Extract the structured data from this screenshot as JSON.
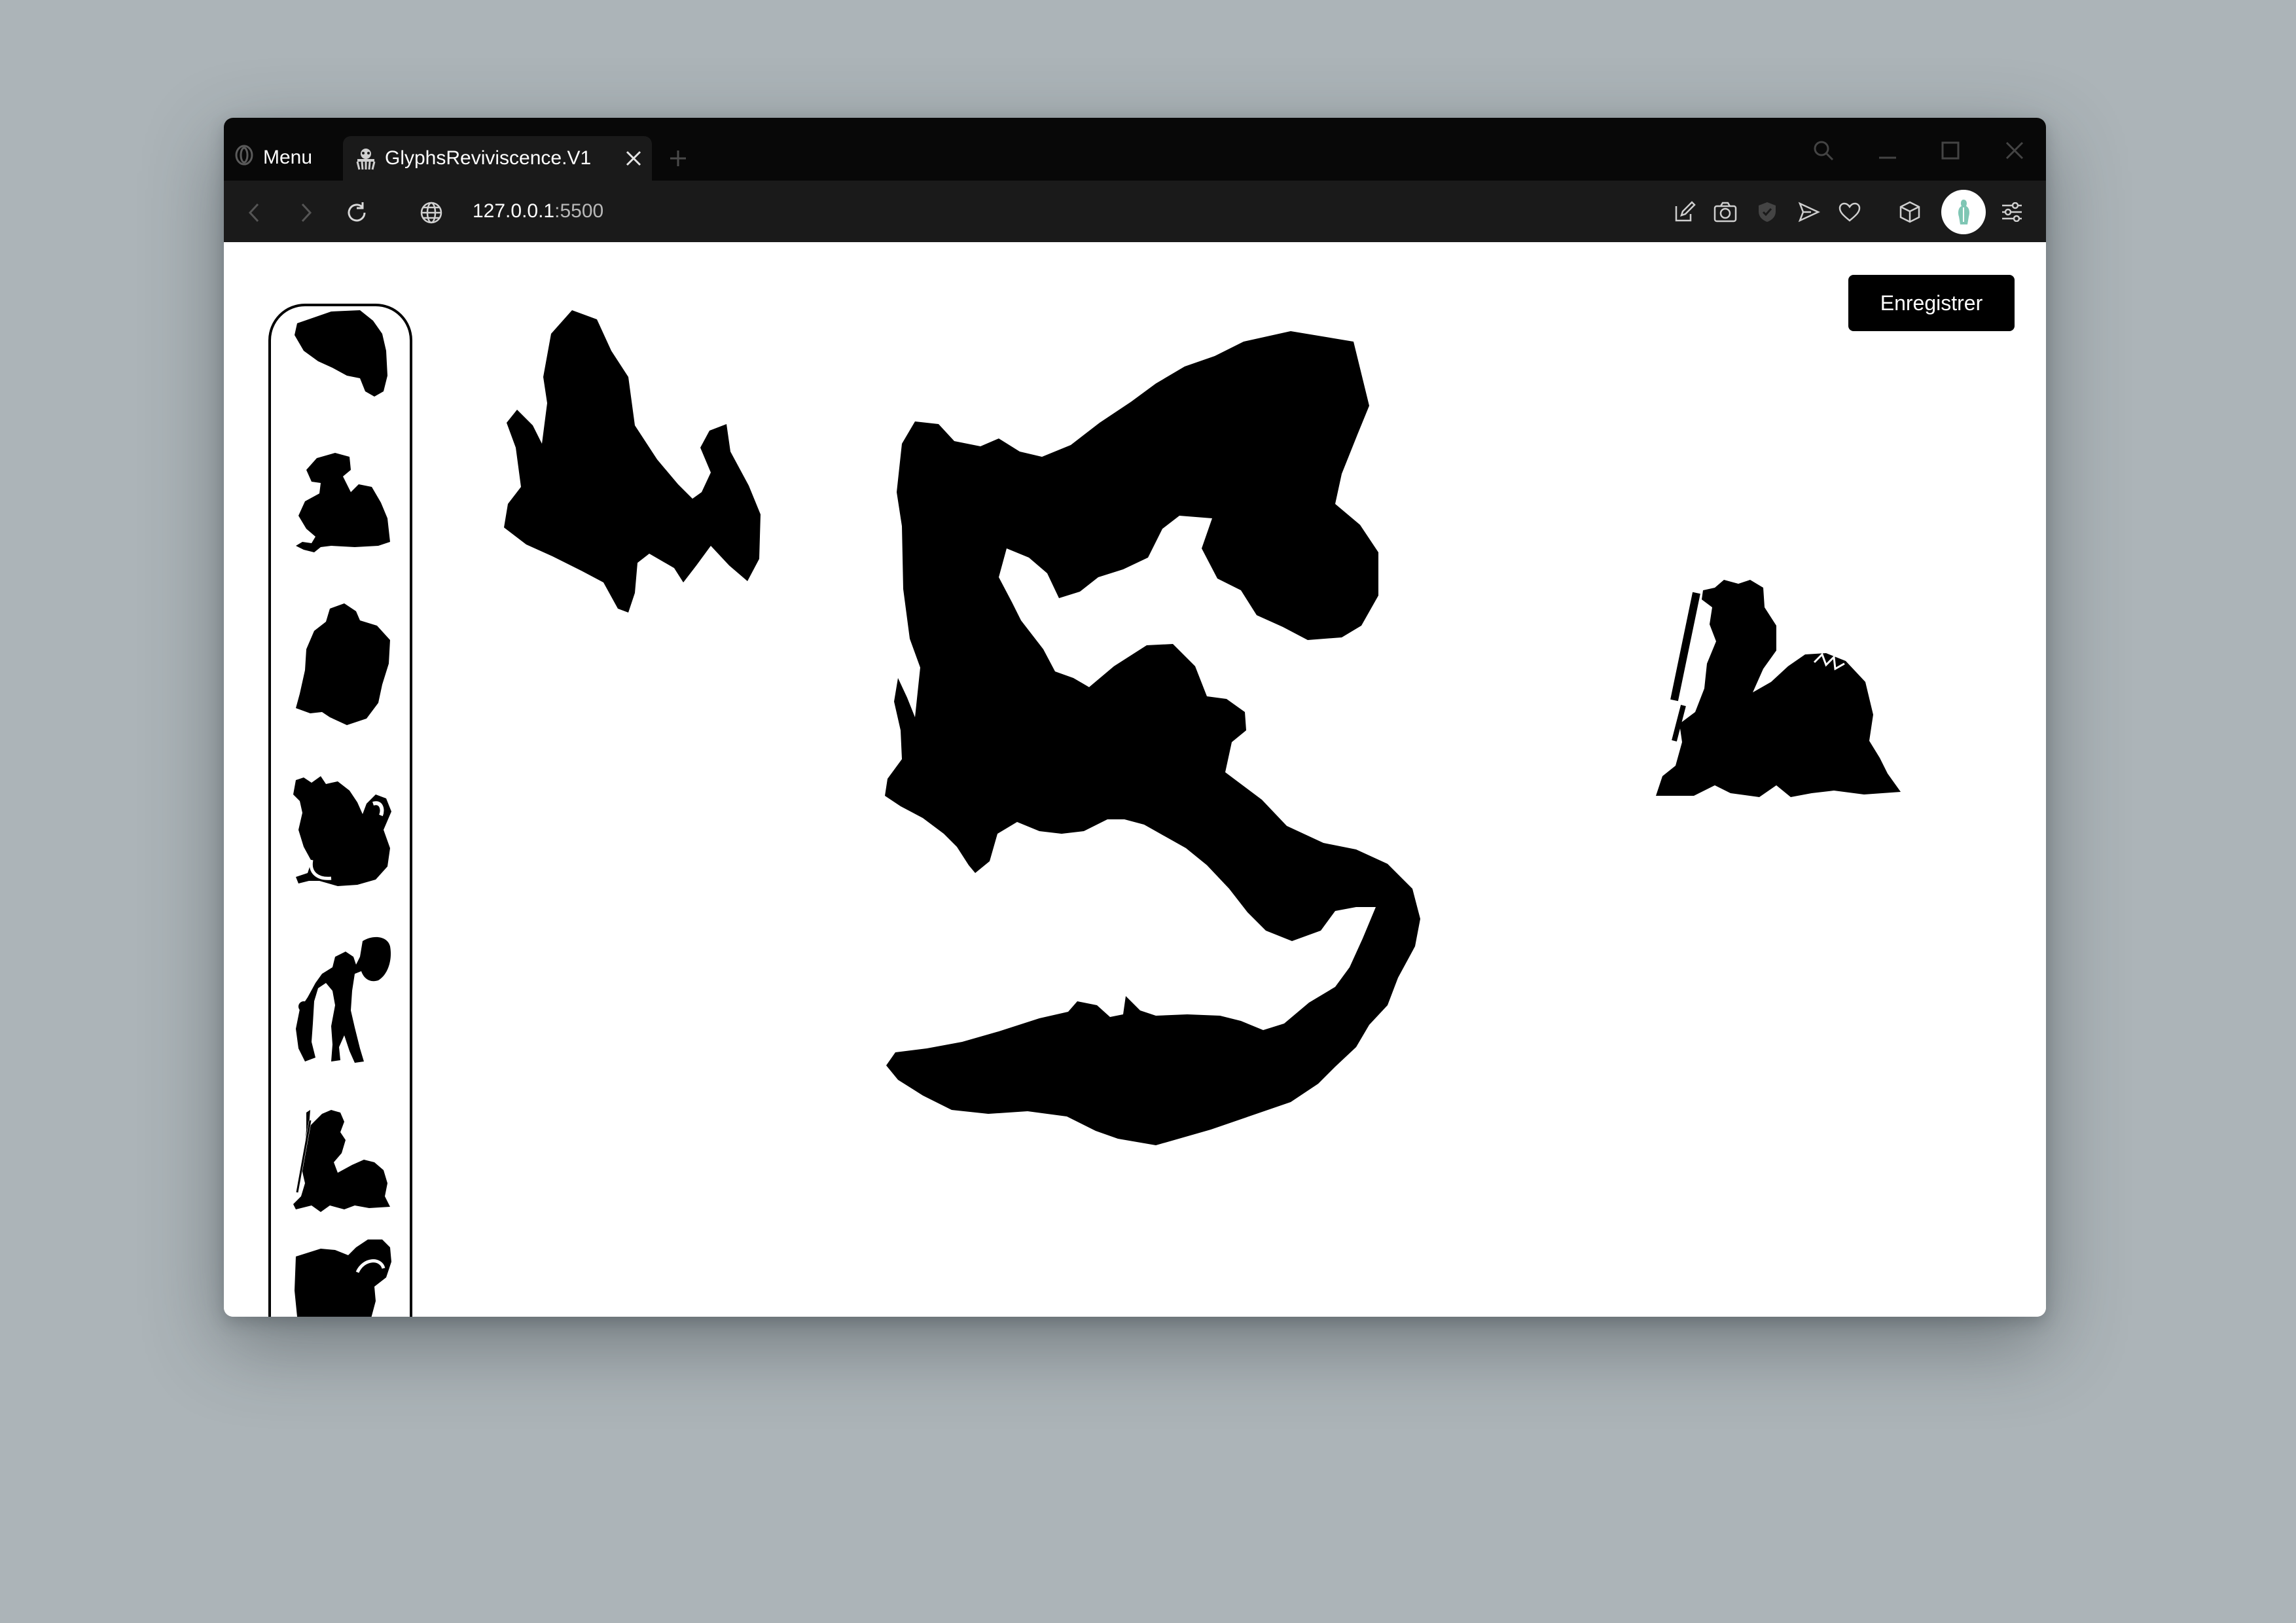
{
  "browser": {
    "menu_label": "Menu",
    "tab_title": "GlyphsReviviscence.V1",
    "url_host": "127.0.0.1",
    "url_port": ":5500",
    "accent_color": "#080808"
  },
  "app": {
    "save_button_label": "Enregistrer",
    "palette_items": [
      {
        "icon": "figure-fragment-icon"
      },
      {
        "icon": "crouching-figure-icon"
      },
      {
        "icon": "torso-fragment-icon"
      },
      {
        "icon": "seated-creature-icon"
      },
      {
        "icon": "warrior-with-shield-icon"
      },
      {
        "icon": "figure-on-lion-icon"
      },
      {
        "icon": "block-fragment-icon"
      }
    ],
    "canvas_pieces": [
      {
        "icon": "rock-fragment-icon"
      },
      {
        "icon": "assembled-relief-icon"
      },
      {
        "icon": "figure-on-lion-icon"
      }
    ]
  }
}
